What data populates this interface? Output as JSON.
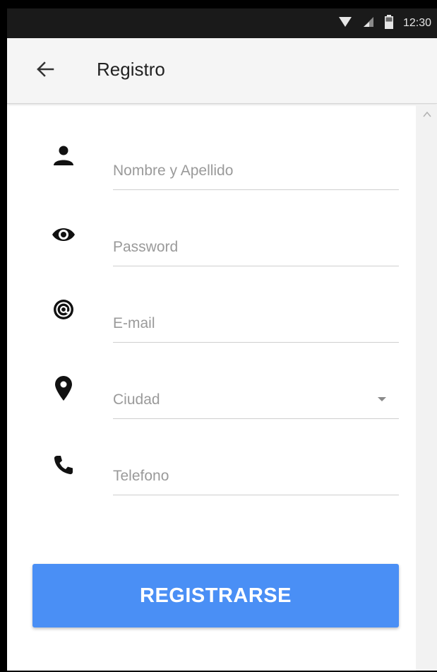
{
  "status_bar": {
    "time": "12:30",
    "icons": [
      "wifi-icon",
      "signal-icon",
      "battery-icon"
    ]
  },
  "app_bar": {
    "title": "Registro",
    "back_icon": "arrow-back-icon"
  },
  "form": {
    "fields": [
      {
        "icon": "person-icon",
        "placeholder": "Nombre y Apellido",
        "value": ""
      },
      {
        "icon": "eye-icon",
        "placeholder": "Password",
        "value": ""
      },
      {
        "icon": "at-icon",
        "placeholder": "E-mail",
        "value": ""
      },
      {
        "icon": "location-pin-icon",
        "placeholder": "Ciudad",
        "value": ""
      },
      {
        "icon": "phone-icon",
        "placeholder": "Telefono",
        "value": ""
      }
    ],
    "submit_label": "REGISTRARSE"
  },
  "colors": {
    "accent": "#4a8ff5",
    "status_bar": "#1a1a1a",
    "app_bar": "#f5f5f5"
  }
}
